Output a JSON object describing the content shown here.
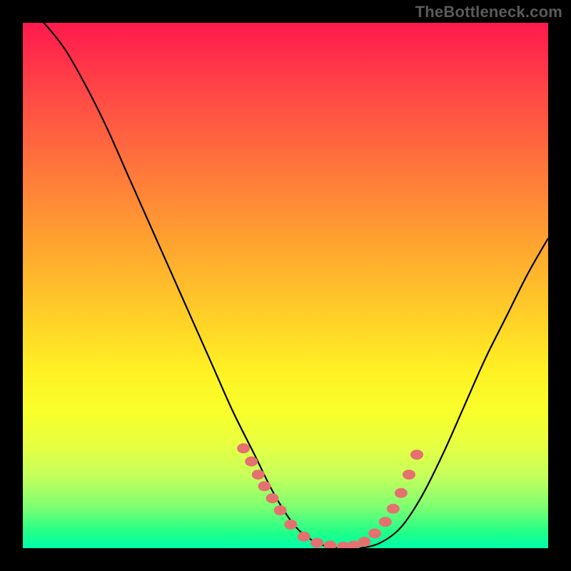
{
  "watermark": "TheBottleneck.com",
  "colors": {
    "bead": "#e4716f",
    "curve": "#000000"
  },
  "chart_data": {
    "type": "line",
    "title": "",
    "xlabel": "",
    "ylabel": "",
    "xlim": [
      0,
      1
    ],
    "ylim": [
      0,
      1
    ],
    "grid": false,
    "legend": false,
    "series": [
      {
        "name": "bottleneck-curve",
        "x": [
          0.0,
          0.04,
          0.08,
          0.12,
          0.16,
          0.2,
          0.24,
          0.28,
          0.32,
          0.36,
          0.4,
          0.44,
          0.48,
          0.52,
          0.56,
          0.6,
          0.64,
          0.68,
          0.72,
          0.76,
          0.8,
          0.84,
          0.88,
          0.92,
          0.96,
          1.0
        ],
        "y": [
          1.04,
          1.0,
          0.95,
          0.88,
          0.8,
          0.71,
          0.62,
          0.53,
          0.44,
          0.35,
          0.26,
          0.18,
          0.1,
          0.04,
          0.01,
          0.0,
          0.0,
          0.01,
          0.04,
          0.1,
          0.18,
          0.27,
          0.36,
          0.44,
          0.52,
          0.59
        ]
      }
    ],
    "highlighted_points": {
      "name": "beads",
      "x": [
        0.42,
        0.435,
        0.448,
        0.46,
        0.475,
        0.49,
        0.51,
        0.535,
        0.56,
        0.585,
        0.61,
        0.63,
        0.65,
        0.67,
        0.69,
        0.705,
        0.72,
        0.735,
        0.75
      ],
      "y": [
        0.19,
        0.165,
        0.14,
        0.118,
        0.095,
        0.072,
        0.045,
        0.022,
        0.01,
        0.005,
        0.003,
        0.005,
        0.012,
        0.028,
        0.05,
        0.075,
        0.105,
        0.14,
        0.178
      ]
    }
  }
}
